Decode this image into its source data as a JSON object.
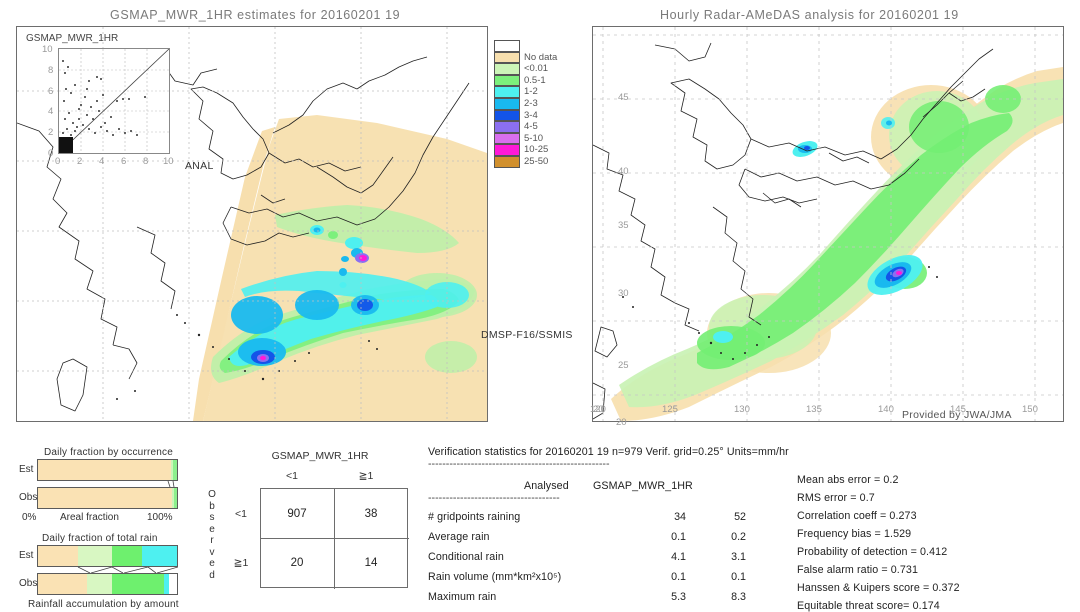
{
  "left_panel": {
    "title": "GSMAP_MWR_1HR estimates for 20160201 19",
    "inset_title": "GSMAP_MWR_1HR",
    "inset_axis_label": "ANAL",
    "inset_ticks": [
      "0",
      "2",
      "4",
      "6",
      "8",
      "10"
    ],
    "sensor_label": "DMSP-F16/SSMIS"
  },
  "right_panel": {
    "title": "Hourly Radar-AMeDAS analysis for 20160201 19",
    "credit": "Provided by JWA/JMA",
    "lon_ticks": [
      "120",
      "125",
      "130",
      "135",
      "140",
      "145",
      "150"
    ],
    "lat_ticks": [
      "45",
      "40",
      "35",
      "30",
      "25",
      "20"
    ],
    "extra_lat_label": "20"
  },
  "colorbar": {
    "entries": [
      {
        "label": "",
        "color": "#ffffff"
      },
      {
        "label": "No data",
        "color": "#f7dfae"
      },
      {
        "label": "<0.01",
        "color": "#ccf5b8"
      },
      {
        "label": "0.5-1",
        "color": "#7cf07c"
      },
      {
        "label": "1-2",
        "color": "#4ef0f0"
      },
      {
        "label": "2-3",
        "color": "#19b9ef"
      },
      {
        "label": "3-4",
        "color": "#1354e8"
      },
      {
        "label": "4-5",
        "color": "#8b6ff0"
      },
      {
        "label": "5-10",
        "color": "#d96fee"
      },
      {
        "label": "10-25",
        "color": "#ff19d8"
      },
      {
        "label": "25-50",
        "color": "#d1902d"
      }
    ]
  },
  "occurrence_chart": {
    "title": "Daily fraction by occurrence",
    "rows": [
      {
        "label": "Est",
        "segments": [
          {
            "color": "#fae2b4",
            "pct": 95.5
          },
          {
            "color": "#ccf5b8",
            "pct": 1.6
          },
          {
            "color": "#8df08d",
            "pct": 2.9
          }
        ]
      },
      {
        "label": "Obs",
        "segments": [
          {
            "color": "#fae2b4",
            "pct": 96.6
          },
          {
            "color": "#ccf5b8",
            "pct": 1.3
          },
          {
            "color": "#8df08d",
            "pct": 2.1
          }
        ]
      }
    ],
    "axis_left": "0%",
    "axis_center": "Areal fraction",
    "axis_right": "100%"
  },
  "amount_chart": {
    "title": "Daily fraction of total rain",
    "footer": "Rainfall accumulation by amount",
    "rows": [
      {
        "label": "Est",
        "segments": [
          {
            "color": "#fae2b4",
            "pct": 29.0
          },
          {
            "color": "#d8f7c2",
            "pct": 24.0
          },
          {
            "color": "#6ef06e",
            "pct": 21.5
          },
          {
            "color": "#4ef0f0",
            "pct": 25.5
          }
        ]
      },
      {
        "label": "Obs",
        "segments": [
          {
            "color": "#fae2b4",
            "pct": 35.5
          },
          {
            "color": "#d8f7c2",
            "pct": 17.5
          },
          {
            "color": "#6ef06e",
            "pct": 38.0
          },
          {
            "color": "#4ef0f0",
            "pct": 3.0
          }
        ]
      }
    ]
  },
  "contingency": {
    "title": "GSMAP_MWR_1HR",
    "col_headers": [
      "<1",
      "≧1"
    ],
    "row_headers": [
      "<1",
      "≧1"
    ],
    "side_label": "Observed",
    "values": [
      [
        "907",
        "38"
      ],
      [
        "20",
        "14"
      ]
    ]
  },
  "verification": {
    "header": "Verification statistics for 20160201 19  n=979  Verif. grid=0.25°  Units=mm/hr",
    "divider": "---------------------------------------------------",
    "table_header": {
      "analysed": "Analysed",
      "model": "GSMAP_MWR_1HR"
    },
    "table_divider": "-------------------------------------",
    "rows": [
      {
        "name": "# gridpoints raining",
        "analysed": "34",
        "model": "52"
      },
      {
        "name": "Average rain",
        "analysed": "0.1",
        "model": "0.2"
      },
      {
        "name": "Conditional rain",
        "analysed": "4.1",
        "model": "3.1"
      },
      {
        "name": "Rain volume (mm*km²x10⁵)",
        "analysed": "0.1",
        "model": "0.1"
      },
      {
        "name": "Maximum rain",
        "analysed": "5.3",
        "model": "8.3"
      }
    ],
    "scores": [
      "Mean abs error = 0.2",
      "RMS error = 0.7",
      "Correlation coeff = 0.273",
      "Frequency bias = 1.529",
      "Probability of detection = 0.412",
      "False alarm ratio = 0.731",
      "Hanssen & Kuipers score = 0.372",
      "Equitable threat score= 0.174"
    ]
  }
}
